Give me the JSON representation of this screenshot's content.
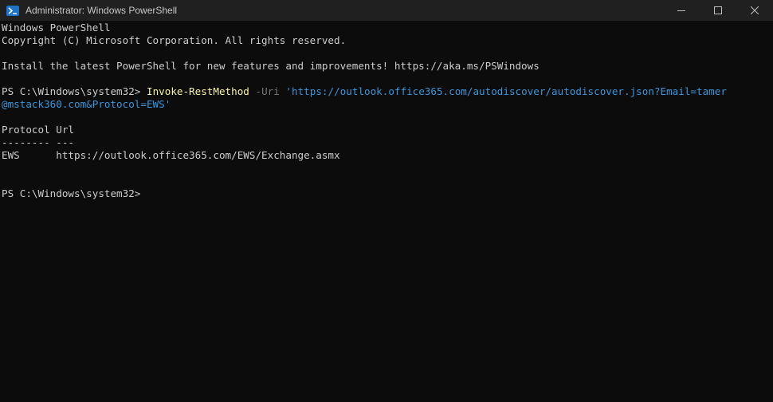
{
  "window": {
    "title": "Administrator: Windows PowerShell",
    "icon": "powershell-icon",
    "controls": [
      "minimize-icon",
      "maximize-icon",
      "close-icon"
    ]
  },
  "colors": {
    "background": "#0c0c0c",
    "text": "#cccccc",
    "command": "#f9f1a5",
    "parameter": "#767676",
    "string": "#3a96dd",
    "titlebar": "#202020"
  },
  "console": {
    "header": [
      "Windows PowerShell",
      "Copyright (C) Microsoft Corporation. All rights reserved."
    ],
    "notice": "Install the latest PowerShell for new features and improvements! https://aka.ms/PSWindows",
    "prompt": "PS C:\\Windows\\system32> ",
    "command": "Invoke-RestMethod",
    "parameter": "-Uri",
    "uri_line1": "'https://outlook.office365.com/autodiscover/autodiscover.json?Email=tamer",
    "uri_line2": "@mstack360.com&Protocol=EWS'",
    "output": {
      "header_row": "Protocol Url",
      "separator_row": "-------- ---",
      "rows": [
        "EWS      https://outlook.office365.com/EWS/Exchange.asmx"
      ]
    },
    "final_prompt": "PS C:\\Windows\\system32>"
  }
}
